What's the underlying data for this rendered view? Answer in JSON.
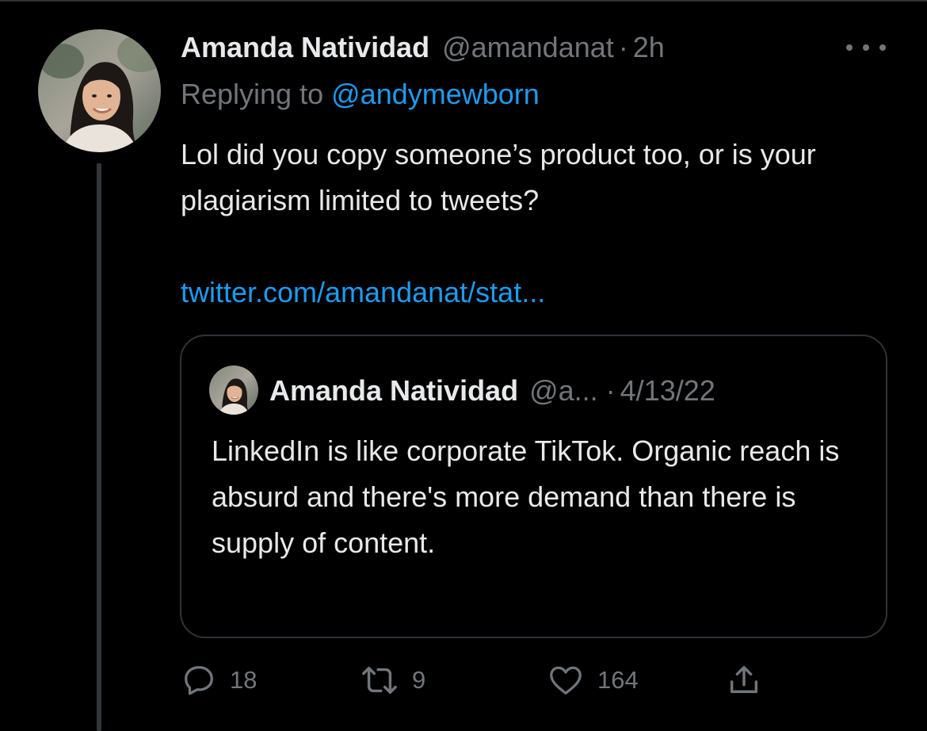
{
  "tweet": {
    "author_name": "Amanda Natividad",
    "author_handle": "@amandanat",
    "separator": "·",
    "time": "2h",
    "replying_prefix": "Replying to",
    "replying_handle": "@andymewborn",
    "text": "Lol did you copy someone’s product too, or is your plagiarism limited to tweets?",
    "link": "twitter.com/amandanat/stat...",
    "avatar_icon": "avatar-photo",
    "more_icon": "more-horizontal-icon"
  },
  "quote": {
    "author_name": "Amanda Natividad",
    "author_handle": "@a...",
    "separator": "·",
    "date": "4/13/22",
    "text": "LinkedIn is like corporate TikTok. Organic reach is absurd and there's more demand than there is supply of content."
  },
  "actions": {
    "reply": {
      "icon": "reply-icon",
      "count": "18"
    },
    "retweet": {
      "icon": "retweet-icon",
      "count": "9"
    },
    "like": {
      "icon": "heart-icon",
      "count": "164"
    },
    "share": {
      "icon": "share-icon"
    }
  },
  "colors": {
    "background": "#000000",
    "text": "#e7e9ea",
    "muted": "#71767b",
    "accent": "#1d9bf0",
    "border": "#2f3336"
  }
}
